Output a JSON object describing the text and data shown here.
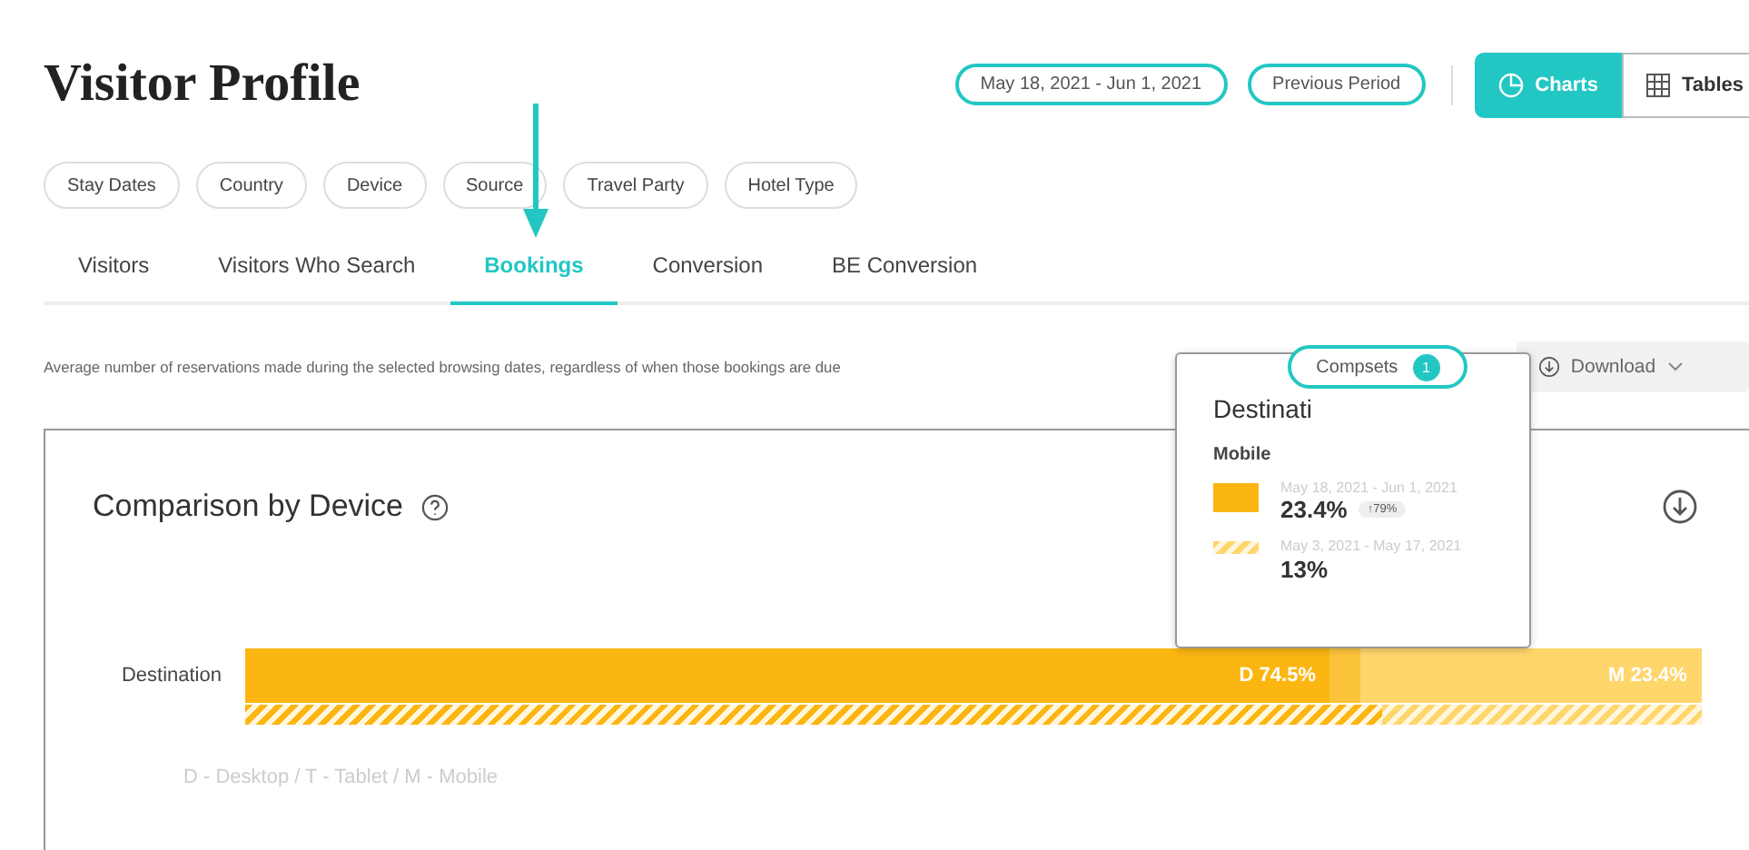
{
  "title": "Visitor Profile",
  "date_range": "May 18, 2021 - Jun 1, 2021",
  "compare_button": "Previous Period",
  "view_toggle": [
    {
      "label": "Charts",
      "kind": "chart",
      "selected": true
    },
    {
      "label": "Tables",
      "kind": "table",
      "selected": false
    }
  ],
  "filters": [
    "Stay Dates",
    "Country",
    "Device",
    "Source",
    "Travel Party",
    "Hotel Type"
  ],
  "tabs": [
    {
      "label": "Visitors",
      "selected": false
    },
    {
      "label": "Visitors Who Search",
      "selected": false
    },
    {
      "label": "Bookings",
      "selected": true
    },
    {
      "label": "Conversion",
      "selected": false
    },
    {
      "label": "BE Conversion",
      "selected": false
    }
  ],
  "description": "Average number of reservations made during the selected browsing dates, regardless of when those bookings are due",
  "compsets": {
    "label": "Compsets",
    "count": "1"
  },
  "download": "Download",
  "card": {
    "title": "Comparison by Device",
    "rows": [
      {
        "label": "Destination",
        "current": [
          {
            "label": "D 74.5%",
            "color": "#fbb612"
          },
          {
            "color": "#fcc43a"
          },
          {
            "label": "M 23.4%",
            "color": "#fed66c"
          }
        ],
        "previous": [
          {
            "color": "#fbb612"
          },
          {
            "color": "#fed66c"
          }
        ]
      }
    ],
    "legend": "D - Desktop / T - Tablet / M - Mobile"
  },
  "tooltip": {
    "title": "Destinati",
    "device": "Mobile",
    "current": {
      "dates": "May 18, 2021 - Jun 1, 2021",
      "value": "23.4%",
      "change": "↑79%",
      "color": "#fbb612"
    },
    "previous": {
      "dates": "May 3, 2021 - May 17, 2021",
      "value": "13%",
      "color": "#fed66c"
    }
  }
}
